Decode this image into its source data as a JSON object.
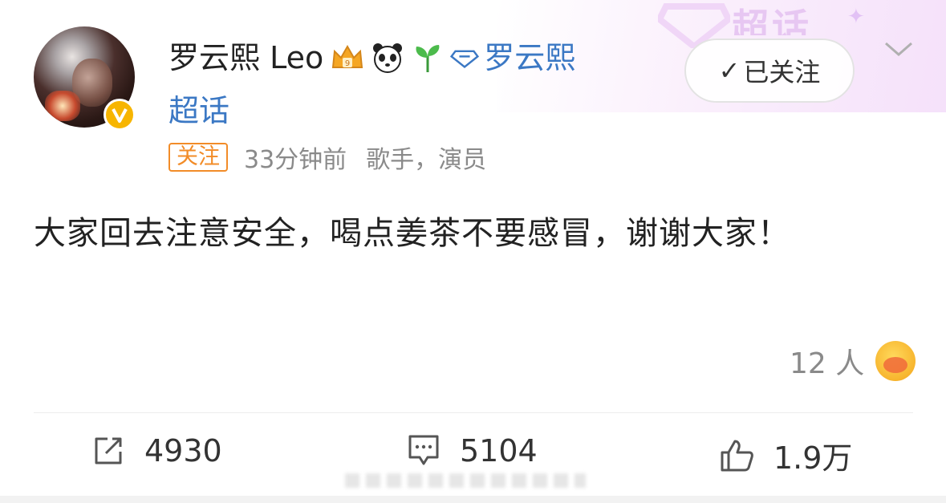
{
  "header": {
    "author_name": "罗云熙 Leo",
    "badge_icons": [
      "crown-icon",
      "panda-icon",
      "sprout-icon"
    ],
    "topic_link": "罗云熙",
    "topic_suffix": "超话",
    "follow_button": "已关注",
    "banner_text": "超话"
  },
  "meta": {
    "tag": "关注",
    "time": "33分钟前",
    "description": "歌手，演员"
  },
  "post": {
    "text": "大家回去注意安全，喝点姜茶不要感冒，谢谢大家！"
  },
  "reactions": {
    "count_label": "12 人",
    "emoji_icon": "sweat-emoji-icon"
  },
  "actions": {
    "repost": "4930",
    "comment": "5104",
    "like": "1.9万"
  },
  "colors": {
    "link": "#3b78c4",
    "tag": "#f28c28",
    "verified": "#f7b500"
  }
}
